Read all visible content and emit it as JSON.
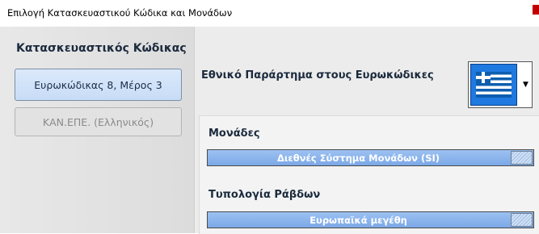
{
  "window": {
    "title": "Επιλογή Κατασκευαστικού Κώδικα και Μονάδων"
  },
  "left_panel": {
    "heading": "Κατασκευαστικός Κώδικας",
    "buttons": [
      {
        "label": "Ευρωκώδικας 8, Μέρος 3",
        "state": "selected"
      },
      {
        "label": "ΚΑΝ.ΕΠΕ. (Ελληνικός)",
        "state": "disabled"
      }
    ]
  },
  "right_panel": {
    "annex_label": "Εθνικό Παράρτημα στους Ευρωκώδικες",
    "annex_selection": {
      "icon": "greece-flag-icon"
    },
    "units": {
      "label": "Μονάδες",
      "value": "Διεθνές Σύστημα Μονάδων (SI)"
    },
    "rebar": {
      "label": "Τυπολογία Ράβδων",
      "value": "Ευρωπαϊκά μεγέθη"
    }
  },
  "colors": {
    "flag_blue": "#1f79e0",
    "dropdown_fill": "#7ba8e6",
    "selected_button": "#c7dcf6",
    "heading_text": "#1b2a3d"
  }
}
